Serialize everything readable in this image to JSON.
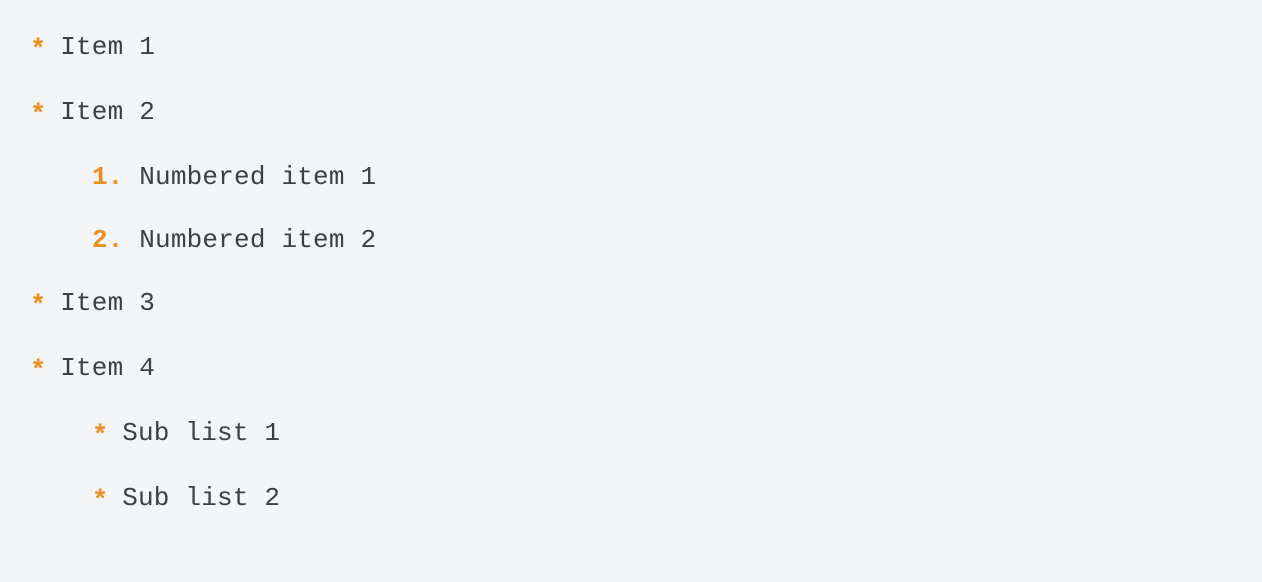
{
  "list": {
    "items": [
      {
        "marker": "*",
        "text": "Item 1"
      },
      {
        "marker": "*",
        "text": "Item 2"
      },
      {
        "marker": "1.",
        "text": "Numbered item 1",
        "indent": 1,
        "numbered": true
      },
      {
        "marker": "2.",
        "text": "Numbered item 2",
        "indent": 1,
        "numbered": true
      },
      {
        "marker": "*",
        "text": "Item 3"
      },
      {
        "marker": "*",
        "text": "Item 4"
      },
      {
        "marker": "*",
        "text": "Sub list 1",
        "indent": 1
      },
      {
        "marker": "*",
        "text": "Sub list 2",
        "indent": 1
      }
    ]
  }
}
